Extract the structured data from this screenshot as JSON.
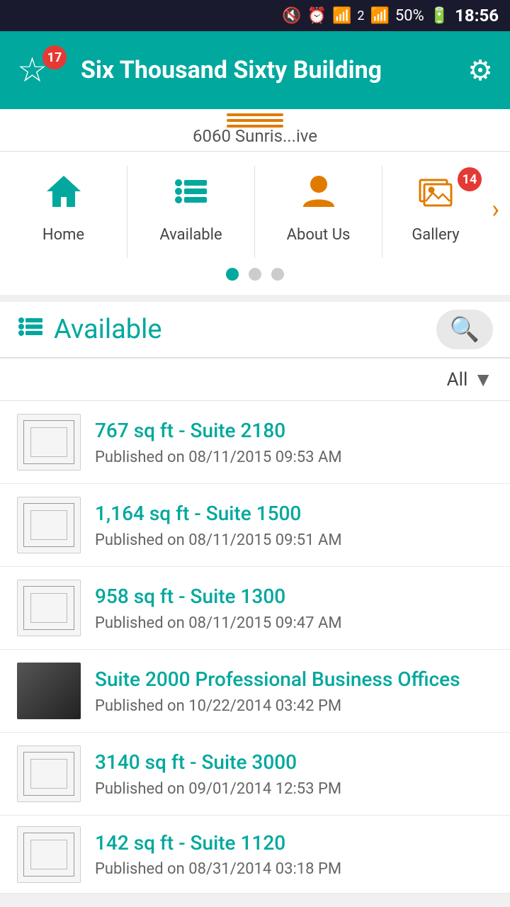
{
  "statusBar": {
    "time": "18:56",
    "battery": "50%"
  },
  "header": {
    "title": "Six Thousand Sixty Building",
    "badge": "17",
    "gearIcon": "⚙"
  },
  "addressBar": {
    "text": "6060 Sunris...ive"
  },
  "nav": {
    "items": [
      {
        "id": "home",
        "label": "Home",
        "iconType": "teal"
      },
      {
        "id": "available",
        "label": "Available",
        "iconType": "teal"
      },
      {
        "id": "about-us",
        "label": "About Us",
        "iconType": "orange"
      },
      {
        "id": "gallery",
        "label": "Gallery",
        "iconType": "orange",
        "badge": "14"
      }
    ]
  },
  "dots": {
    "count": 3,
    "active": 0
  },
  "available": {
    "title": "Available",
    "filterLabel": "All",
    "items": [
      {
        "id": 1,
        "title": "767 sq ft - Suite 2180",
        "date": "Published on 08/11/2015 09:53 AM",
        "thumbType": "blueprint"
      },
      {
        "id": 2,
        "title": "1,164 sq ft - Suite 1500",
        "date": "Published on 08/11/2015 09:51 AM",
        "thumbType": "blueprint"
      },
      {
        "id": 3,
        "title": "958 sq ft - Suite 1300",
        "date": "Published on 08/11/2015 09:47 AM",
        "thumbType": "blueprint"
      },
      {
        "id": 4,
        "title": "Suite 2000 Professional Business Offices",
        "date": "Published on 10/22/2014 03:42 PM",
        "thumbType": "photo"
      },
      {
        "id": 5,
        "title": "3140 sq ft - Suite 3000",
        "date": "Published on 09/01/2014 12:53 PM",
        "thumbType": "blueprint"
      },
      {
        "id": 6,
        "title": "142 sq ft - Suite 1120",
        "date": "Published on 08/31/2014 03:18 PM",
        "thumbType": "blueprint"
      }
    ]
  }
}
